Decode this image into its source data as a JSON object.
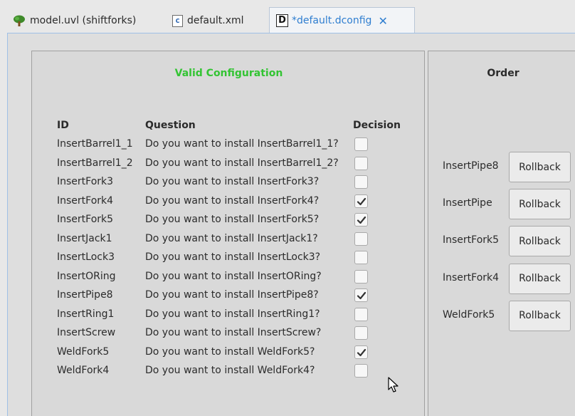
{
  "tabs": [
    {
      "label": "model.uvl (shiftforks)",
      "icon": "tree-icon"
    },
    {
      "label": "default.xml",
      "icon": "xml-file-icon",
      "icon_glyph": "c"
    },
    {
      "label": "*default.dconfig",
      "icon": "dconfig-icon",
      "icon_glyph": "D",
      "active": true,
      "close": "✕"
    }
  ],
  "config": {
    "status": "Valid Configuration",
    "status_color": "#33c433",
    "headers": {
      "id": "ID",
      "question": "Question",
      "decision": "Decision"
    },
    "rows": [
      {
        "id": "InsertBarrel1_1",
        "question": "Do you want to install InsertBarrel1_1?",
        "checked": false
      },
      {
        "id": "InsertBarrel1_2",
        "question": "Do you want to install InsertBarrel1_2?",
        "checked": false
      },
      {
        "id": "InsertFork3",
        "question": "Do you want to install InsertFork3?",
        "checked": false
      },
      {
        "id": "InsertFork4",
        "question": "Do you want to install InsertFork4?",
        "checked": true
      },
      {
        "id": "InsertFork5",
        "question": "Do you want to install InsertFork5?",
        "checked": true
      },
      {
        "id": "InsertJack1",
        "question": "Do you want to install InsertJack1?",
        "checked": false
      },
      {
        "id": "InsertLock3",
        "question": "Do you want to install InsertLock3?",
        "checked": false
      },
      {
        "id": "InsertORing",
        "question": "Do you want to install InsertORing?",
        "checked": false
      },
      {
        "id": "InsertPipe8",
        "question": "Do you want to install InsertPipe8?",
        "checked": true
      },
      {
        "id": "InsertRing1",
        "question": "Do you want to install InsertRing1?",
        "checked": false
      },
      {
        "id": "InsertScrew",
        "question": "Do you want to install InsertScrew?",
        "checked": false
      },
      {
        "id": "WeldFork5",
        "question": "Do you want to install WeldFork5?",
        "checked": true
      },
      {
        "id": "WeldFork4",
        "question": "Do you want to install WeldFork4?",
        "checked": false
      }
    ]
  },
  "order": {
    "title": "Order",
    "items": [
      {
        "id": "InsertPipe8",
        "button": "Rollback"
      },
      {
        "id": "InsertPipe",
        "button": "Rollback"
      },
      {
        "id": "InsertFork5",
        "button": "Rollback"
      },
      {
        "id": "InsertFork4",
        "button": "Rollback"
      },
      {
        "id": "WeldFork5",
        "button": "Rollback"
      }
    ]
  }
}
